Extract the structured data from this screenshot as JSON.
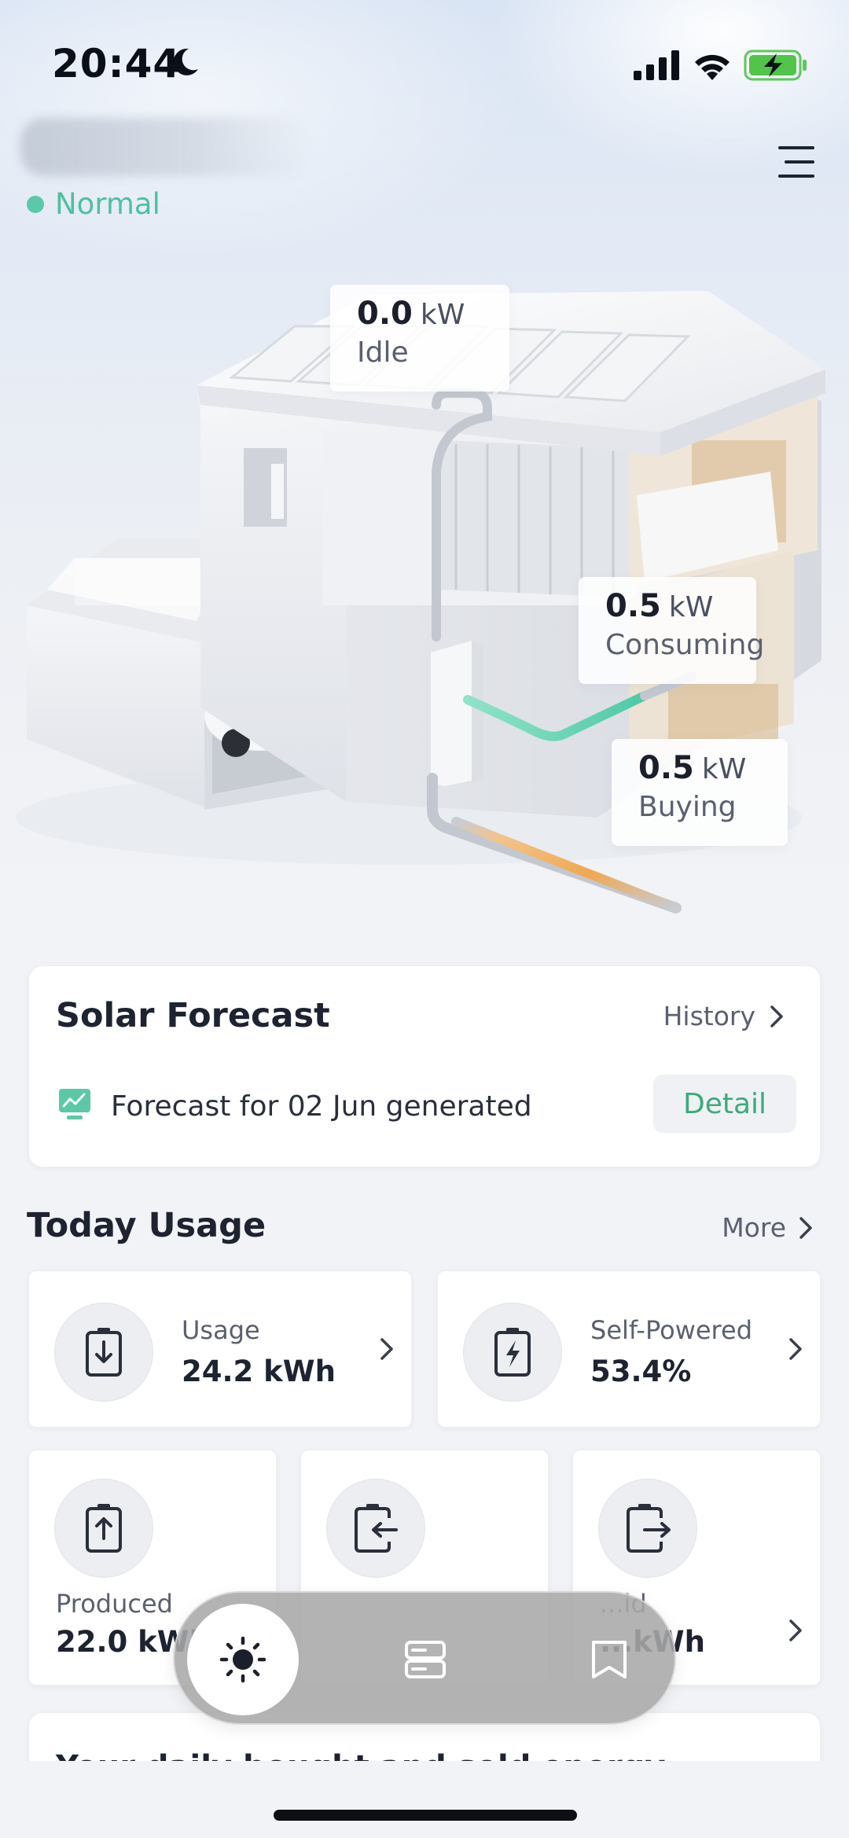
{
  "status_bar": {
    "time": "20:44",
    "icons": [
      "moon-icon",
      "signal-icon",
      "wifi-icon",
      "battery-charging-icon"
    ]
  },
  "header": {
    "site_name_blurred": true,
    "status": "Normal",
    "status_color": "#5cc8a8",
    "menu_icon": "hamburger-menu-icon"
  },
  "energy_flow": {
    "solar": {
      "value": "0.0",
      "unit": "kW",
      "state": "Idle"
    },
    "home": {
      "value": "0.5",
      "unit": "kW",
      "state": "Consuming"
    },
    "grid": {
      "value": "0.5",
      "unit": "kW",
      "state": "Buying"
    },
    "colors": {
      "consuming": "#58d6b0",
      "buying": "#f0a850"
    }
  },
  "solar_forecast": {
    "title": "Solar Forecast",
    "history_label": "History",
    "message": "Forecast for 02 Jun generated",
    "detail_label": "Detail",
    "icon": "chart-monitor-icon"
  },
  "today_usage": {
    "title": "Today Usage",
    "more_label": "More",
    "usage": {
      "label": "Usage",
      "value": "24.2 kWh",
      "icon": "battery-download-icon"
    },
    "self_powered": {
      "label": "Self-Powered",
      "value": "53.4%",
      "icon": "battery-bolt-icon"
    },
    "produced": {
      "label": "Produced",
      "value": "22.0 kWh",
      "icon": "battery-upload-icon"
    },
    "imported": {
      "label": "",
      "value": "",
      "icon": "battery-import-icon"
    },
    "exported": {
      "label": "...id",
      "value": "...kWh",
      "icon": "battery-export-icon"
    }
  },
  "daily_card": {
    "title": "Your daily bought and sold energy"
  },
  "bottom_nav": {
    "items": [
      "sun-icon",
      "devices-icon",
      "book-icon"
    ],
    "active": "sun-icon"
  }
}
